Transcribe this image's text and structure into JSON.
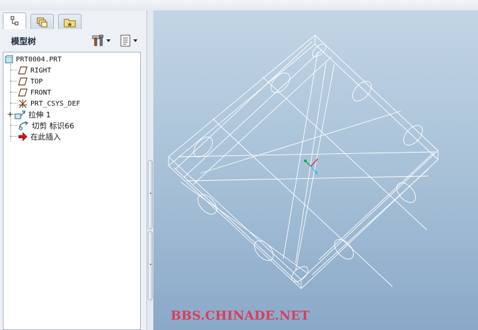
{
  "panel": {
    "tabs": [
      {
        "name": "model-tree-tab",
        "icon": "model-tree-icon",
        "active": true
      },
      {
        "name": "layers-tab",
        "icon": "layers-icon",
        "active": false
      },
      {
        "name": "favorites-tab",
        "icon": "favorites-folder-icon",
        "active": false
      }
    ],
    "title": "模型树",
    "settings_icon": "settings-tools-icon",
    "show_icon": "show-list-icon"
  },
  "tree": {
    "items": [
      {
        "label": "PRT0004.PRT",
        "icon": "part-icon"
      },
      {
        "label": "RIGHT",
        "icon": "datum-plane-icon"
      },
      {
        "label": "TOP",
        "icon": "datum-plane-icon"
      },
      {
        "label": "FRONT",
        "icon": "datum-plane-icon"
      },
      {
        "label": "PRT_CSYS_DEF",
        "icon": "coordinate-system-icon"
      },
      {
        "label": "拉伸 1",
        "icon": "extrude-icon"
      },
      {
        "label": "切剪 标识66",
        "icon": "cut-icon"
      },
      {
        "label": "在此插入",
        "icon": "insert-here-arrow-icon"
      }
    ]
  },
  "viewport": {
    "watermark": "BBS.CHINADE.NET",
    "background_top": "#c2d5e5",
    "background_bottom": "#8aa9c8",
    "wire_color": "#ffffff"
  }
}
